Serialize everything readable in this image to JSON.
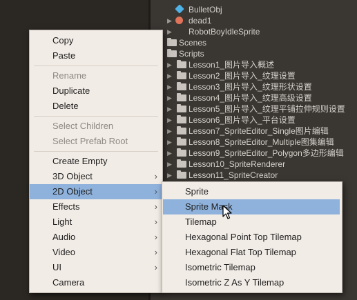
{
  "project_tree": {
    "items": [
      {
        "label": "BulletObj",
        "icon": "prefab-cube-icon",
        "arrow": ""
      },
      {
        "label": "dead1",
        "icon": "sprite-icon",
        "arrow": "▶"
      },
      {
        "label": "RobotBoyIdleSprite",
        "icon": "",
        "arrow": "▶"
      },
      {
        "label": "Scenes",
        "icon": "folder-icon",
        "arrow": ""
      },
      {
        "label": "Scripts",
        "icon": "folder-icon",
        "arrow": ""
      },
      {
        "label": "Lesson1_图片导入概述",
        "icon": "folder-icon",
        "arrow": "▶"
      },
      {
        "label": "Lesson2_图片导入_纹理设置",
        "icon": "folder-icon",
        "arrow": "▶"
      },
      {
        "label": "Lesson3_图片导入_纹理形状设置",
        "icon": "folder-icon",
        "arrow": "▶"
      },
      {
        "label": "Lesson4_图片导入_纹理高级设置",
        "icon": "folder-icon",
        "arrow": "▶"
      },
      {
        "label": "Lesson5_图片导入_纹理平铺拉伸规则设置",
        "icon": "folder-icon",
        "arrow": "▶"
      },
      {
        "label": "Lesson6_图片导入_平台设置",
        "icon": "folder-icon",
        "arrow": "▶"
      },
      {
        "label": "Lesson7_SpriteEditor_Single图片编辑",
        "icon": "folder-icon",
        "arrow": "▶"
      },
      {
        "label": "Lesson8_SpriteEditor_Multiple图集编辑",
        "icon": "folder-icon",
        "arrow": "▶"
      },
      {
        "label": "Lesson9_SpriteEditor_Polygon多边形编辑",
        "icon": "folder-icon",
        "arrow": "▶"
      },
      {
        "label": "Lesson10_SpriteRenderer",
        "icon": "folder-icon",
        "arrow": "▶"
      },
      {
        "label": "Lesson11_SpriteCreator",
        "icon": "folder-icon",
        "arrow": "▶"
      }
    ]
  },
  "context_menu": {
    "items": [
      {
        "label": "Copy",
        "enabled": true
      },
      {
        "label": "Paste",
        "enabled": true
      },
      {
        "label": "Rename",
        "enabled": false
      },
      {
        "label": "Duplicate",
        "enabled": true
      },
      {
        "label": "Delete",
        "enabled": true
      },
      {
        "label": "Select Children",
        "enabled": false
      },
      {
        "label": "Select Prefab Root",
        "enabled": false
      },
      {
        "label": "Create Empty",
        "enabled": true
      },
      {
        "label": "3D Object",
        "enabled": true,
        "submenu": true
      },
      {
        "label": "2D Object",
        "enabled": true,
        "submenu": true,
        "active": true
      },
      {
        "label": "Effects",
        "enabled": true,
        "submenu": true
      },
      {
        "label": "Light",
        "enabled": true,
        "submenu": true
      },
      {
        "label": "Audio",
        "enabled": true,
        "submenu": true
      },
      {
        "label": "Video",
        "enabled": true,
        "submenu": true
      },
      {
        "label": "UI",
        "enabled": true,
        "submenu": true
      },
      {
        "label": "Camera",
        "enabled": true
      }
    ],
    "chevron": "›"
  },
  "submenu_2d": {
    "items": [
      {
        "label": "Sprite"
      },
      {
        "label": "Sprite Mask",
        "highlighted": true
      },
      {
        "label": "Tilemap"
      },
      {
        "label": "Hexagonal Point Top Tilemap"
      },
      {
        "label": "Hexagonal Flat Top Tilemap"
      },
      {
        "label": "Isometric Tilemap"
      },
      {
        "label": "Isometric Z As Y Tilemap"
      }
    ]
  },
  "colors": {
    "menu_bg": "#f2ece6",
    "highlight": "#8fb2dc",
    "panel_bg": "#3a3632"
  }
}
